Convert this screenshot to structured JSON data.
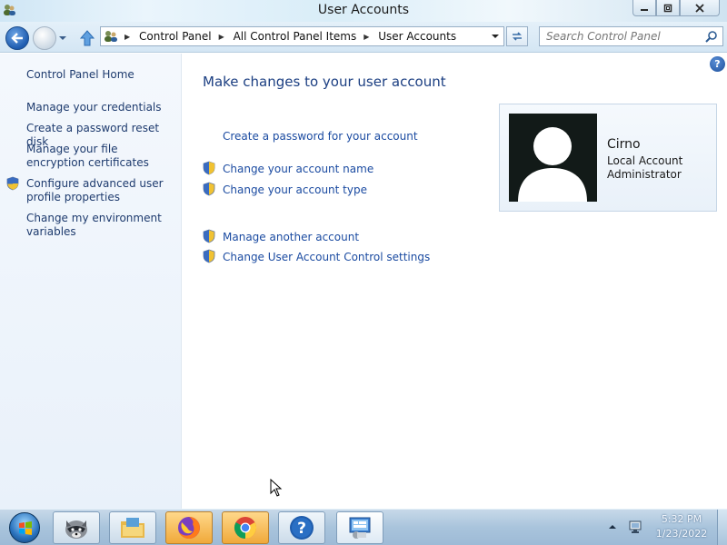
{
  "window": {
    "title": "User Accounts"
  },
  "address_bar": {
    "breadcrumbs": [
      "Control Panel",
      "All Control Panel Items",
      "User Accounts"
    ]
  },
  "search": {
    "placeholder": "Search Control Panel"
  },
  "left_pane": {
    "home": "Control Panel Home",
    "links": [
      {
        "label": "Manage your credentials"
      },
      {
        "label": "Create a password reset disk"
      },
      {
        "label": "Manage your file encryption certificates"
      },
      {
        "label": "Configure advanced user profile properties",
        "icon": "uac-shield-icon"
      },
      {
        "label": "Change my environment variables"
      }
    ]
  },
  "main": {
    "heading": "Make changes to your user account",
    "tasks": [
      {
        "label": "Create a password for your account"
      },
      {
        "label": "Change your account name",
        "icon": "uac-shield-icon"
      },
      {
        "label": "Change your account type",
        "icon": "uac-shield-icon"
      }
    ],
    "other_tasks": [
      {
        "label": "Manage another account",
        "icon": "uac-shield-icon"
      },
      {
        "label": "Change User Account Control settings",
        "icon": "uac-shield-icon"
      }
    ],
    "user": {
      "name": "Cirno",
      "account_type": "Local Account",
      "role": "Administrator"
    }
  },
  "taskbar": {
    "pinned": [
      "raccoon-app-icon",
      "file-explorer-icon",
      "firefox-icon",
      "chrome-icon",
      "help-icon",
      "control-panel-icon"
    ],
    "clock": {
      "time": "5:32 PM",
      "date": "1/23/2022"
    }
  },
  "colors": {
    "link": "#1b4ba1",
    "heading": "#1c3f82",
    "left_link": "#1e3b6e"
  }
}
